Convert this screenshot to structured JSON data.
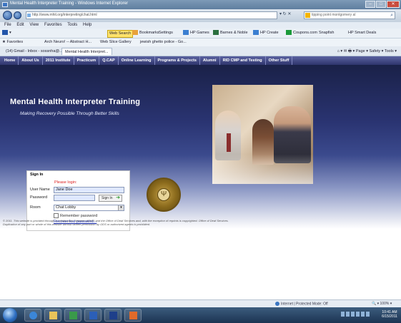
{
  "window": {
    "title": "Mental Health Interpreter Training - Windows Internet Explorer"
  },
  "address_bar": {
    "url": "http://www.mhit.org/interpreting/chat.html",
    "search_placeholder": "tipping point montgomery al"
  },
  "menu": [
    "File",
    "Edit",
    "View",
    "Favorites",
    "Tools",
    "Help"
  ],
  "toolbar": {
    "web_search": "Web Search",
    "bookmarks": "Bookmarks",
    "settings": "Settings",
    "hp_games": "HP Games",
    "barnes": "Barnes & Noble",
    "hp_create": "HP Create",
    "coupons": "Coupons.com",
    "snapfish": "Snapfish",
    "hp_smart": "HP Smart Deals"
  },
  "favorites": {
    "label": "Favorites",
    "items": [
      "Arch Neuro! -- Abstract H...",
      "Web Slice Gallery",
      "jewish ghetto police - Go..."
    ]
  },
  "tabs": [
    {
      "label": "(14) Gmail - Inbox - sossnha@..."
    },
    {
      "label": "Mental Health Interpret...",
      "active": true
    }
  ],
  "command_bar": {
    "page": "Page",
    "safety": "Safety",
    "tools": "Tools"
  },
  "site_nav": [
    "Home",
    "About Us",
    "2011 Institute",
    "Practicum",
    "Q.CAP",
    "Online Learning",
    "Programs & Projects",
    "Alumni",
    "RID CMP and Testing",
    "Other Stuff"
  ],
  "banner": {
    "title": "Mental Health Interpreter Training",
    "tagline": "Making Recovery Possible Through Better Skills"
  },
  "login": {
    "heading": "Sign In",
    "please": "Please login:",
    "user_label": "User Name",
    "user_value": "Jane Doe",
    "password_label": "Password",
    "signin_button": "Sign In",
    "room_label": "Room",
    "room_value": "Chat Lobby",
    "remember": "Remember password",
    "recover": "Recover lost password..."
  },
  "footer": {
    "text": "© 2011. This website is provided through a collaboration between ADMH and the Office of Deaf Services and, with the exception of reprints is copyrighted. Office of Deaf Services. Duplication of any part or whole of this website without written permission by ODS or authorized agents is prohibited."
  },
  "status": {
    "zone": "Internet | Protected Mode: Off",
    "zoom": "100%"
  },
  "clock": {
    "time": "10:41 AM",
    "date": "6/15/2011"
  }
}
